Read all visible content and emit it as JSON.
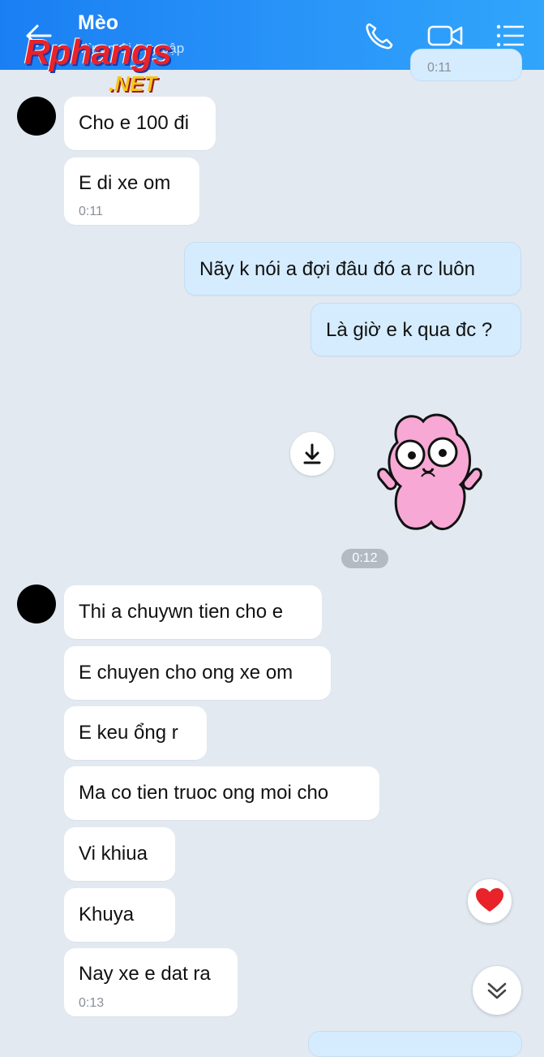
{
  "header": {
    "title": "Mèo",
    "subtitle": "Vừa mới truy cập",
    "back_icon": "arrow-left-icon",
    "call_icon": "phone-icon",
    "video_icon": "video-camera-icon",
    "menu_icon": "list-menu-icon",
    "background": "#1a7ff3"
  },
  "watermark": {
    "main": "Rphangs",
    "sub": ".NET"
  },
  "top_cut_time": "0:11",
  "messages": [
    {
      "text": "Cho e 100 đi"
    },
    {
      "text": "E di xe om",
      "time": "0:11"
    },
    {
      "text": "Nãy k nói a đợi đâu đó a rc luôn"
    },
    {
      "text": "Là giờ e k qua đc ?"
    },
    {
      "text": "Thi a chuywn tien cho e"
    },
    {
      "text": "E chuyen cho ong xe om"
    },
    {
      "text": "E keu ổng r"
    },
    {
      "text": "Ma co tien truoc ong moi cho"
    },
    {
      "text": "Vi khiua"
    },
    {
      "text": "Khuya"
    },
    {
      "text": "Nay xe e dat ra",
      "time": "0:13"
    }
  ],
  "sticker": {
    "icon": "pink-bunny-sticker",
    "time": "0:12"
  },
  "controls": {
    "download_icon": "download-icon",
    "heart_icon": "heart-icon",
    "scroll_down_icon": "chevron-double-down-icon"
  },
  "colors": {
    "incoming_bubble": "#ffffff",
    "outgoing_bubble": "#d5ecff",
    "chat_background": "#e2e9f1",
    "heart": "#e8232a"
  }
}
